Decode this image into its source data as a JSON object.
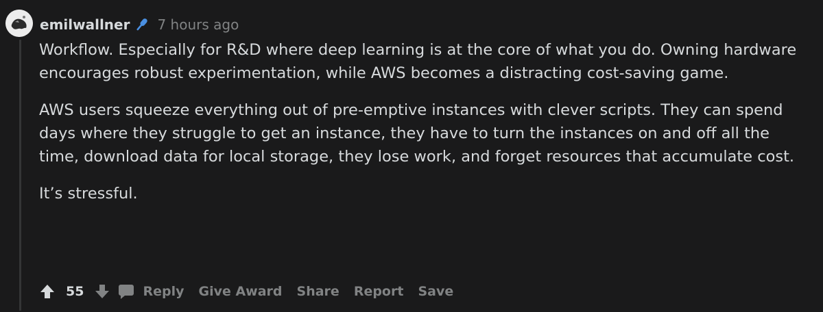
{
  "comment": {
    "author": "emilwallner",
    "flair_icon": "microphone-icon",
    "timestamp": "7 hours ago",
    "paragraphs": [
      "Workflow. Especially for R&D where deep learning is at the core of what you do. Owning hardware encourages robust experimentation, while AWS becomes a distracting cost-saving game.",
      "AWS users squeeze everything out of pre-emptive instances with clever scripts. They can spend days where they struggle to get an instance, they have to turn the instances on and off all the time, download data for local storage, they lose work, and forget resources that accumulate cost.",
      "It’s stressful."
    ],
    "score": "55",
    "actions": {
      "reply": "Reply",
      "give_award": "Give Award",
      "share": "Share",
      "report": "Report",
      "save": "Save"
    }
  },
  "colors": {
    "background": "#1a1a1b",
    "text": "#d7dadc",
    "muted": "#818384",
    "thread_line": "#343536",
    "flair_blue": "#4a90e2"
  }
}
